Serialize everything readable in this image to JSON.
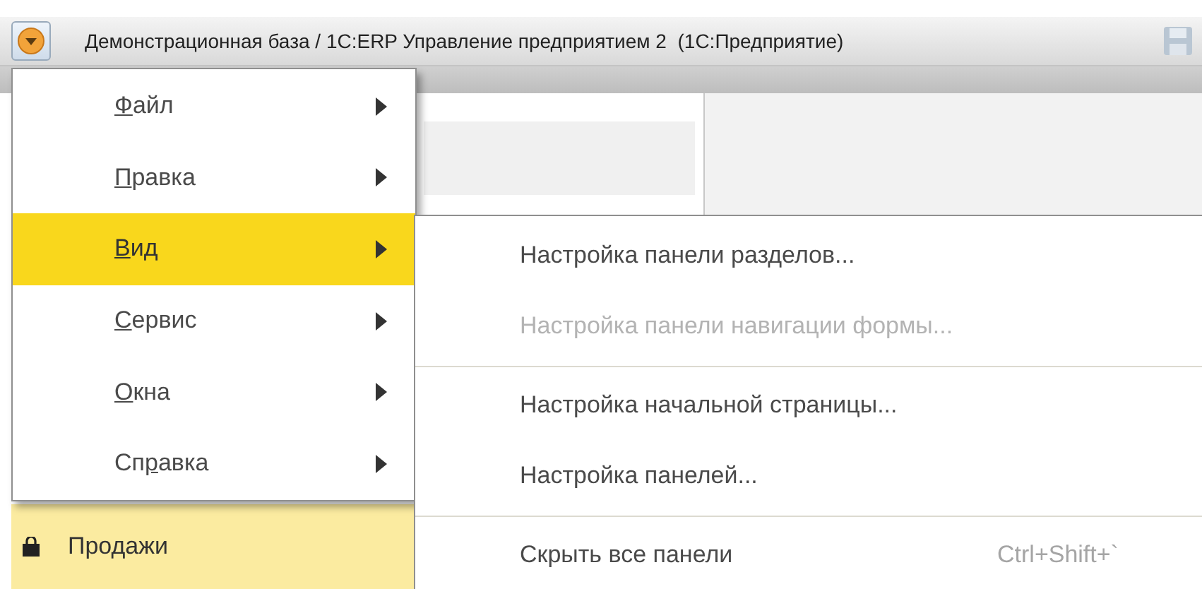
{
  "window": {
    "title": "Демонстрационная база / 1С:ERP Управление предприятием 2  (1С:Предприятие)"
  },
  "sections": [
    {
      "label": "Продажи",
      "selected": true
    }
  ],
  "main_menu": [
    {
      "label_parts": [
        {
          "text": "Ф",
          "underlined": true
        },
        {
          "text": "айл",
          "underlined": false
        }
      ],
      "selected": false
    },
    {
      "label_parts": [
        {
          "text": "П",
          "underlined": true
        },
        {
          "text": "равка",
          "underlined": false
        }
      ],
      "selected": false
    },
    {
      "label_parts": [
        {
          "text": "В",
          "underlined": true
        },
        {
          "text": "ид",
          "underlined": false
        }
      ],
      "selected": true
    },
    {
      "label_parts": [
        {
          "text": "С",
          "underlined": true
        },
        {
          "text": "ервис",
          "underlined": false
        }
      ],
      "selected": false
    },
    {
      "label_parts": [
        {
          "text": "О",
          "underlined": true
        },
        {
          "text": "кна",
          "underlined": false
        }
      ],
      "selected": false
    },
    {
      "label_parts": [
        {
          "text": "Сп",
          "underlined": false
        },
        {
          "text": "р",
          "underlined": true
        },
        {
          "text": "авка",
          "underlined": false
        }
      ],
      "selected": false
    }
  ],
  "submenu": [
    {
      "kind": "item",
      "label": "Настройка панели разделов...",
      "disabled": false
    },
    {
      "kind": "item",
      "label": "Настройка панели навигации формы...",
      "disabled": true
    },
    {
      "kind": "separator"
    },
    {
      "kind": "item",
      "label": "Настройка начальной страницы...",
      "disabled": false
    },
    {
      "kind": "item",
      "label": "Настройка панелей...",
      "disabled": false
    },
    {
      "kind": "separator"
    },
    {
      "kind": "item",
      "label": "Скрыть все панели",
      "disabled": false,
      "shortcut": "Ctrl+Shift+`"
    }
  ]
}
